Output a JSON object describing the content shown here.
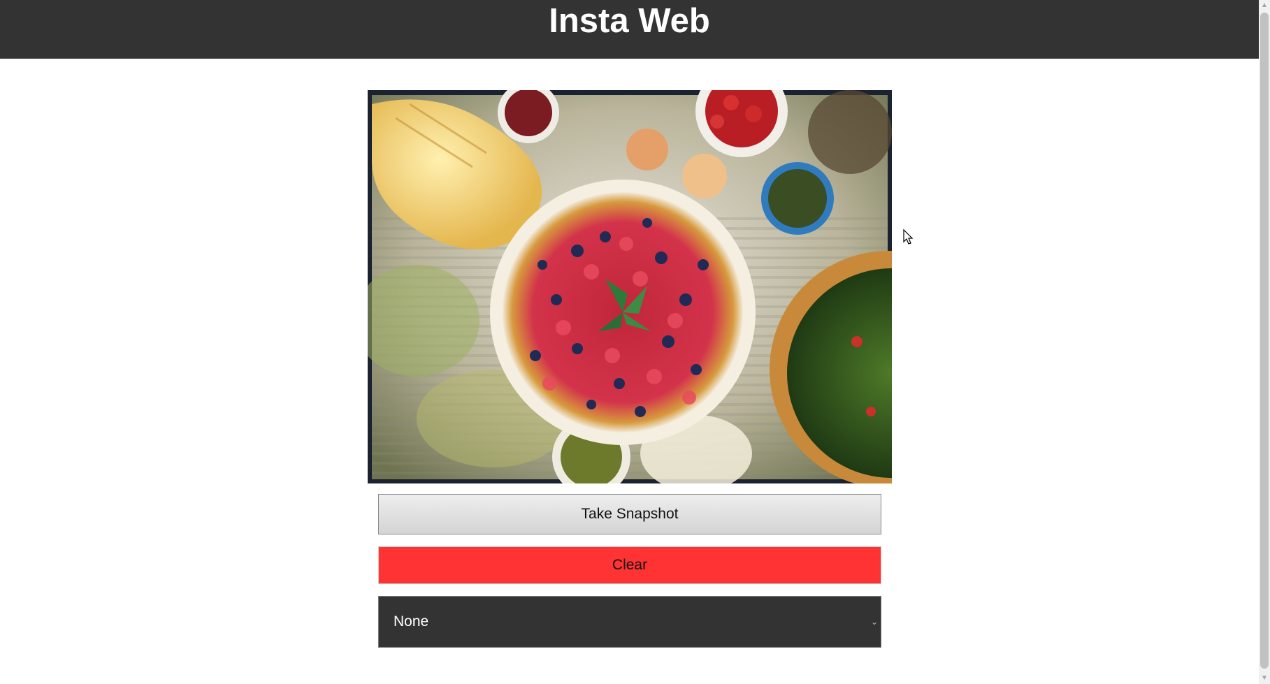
{
  "header": {
    "title": "Insta Web"
  },
  "media": {
    "icon": "camera-preview",
    "subject": "berry tart"
  },
  "controls": {
    "snapshot_label": "Take Snapshot",
    "clear_label": "Clear",
    "filter": {
      "selected": "None"
    }
  },
  "colors": {
    "header_bg": "#333333",
    "clear_button": "#ff3333",
    "select_bg": "#333333"
  }
}
